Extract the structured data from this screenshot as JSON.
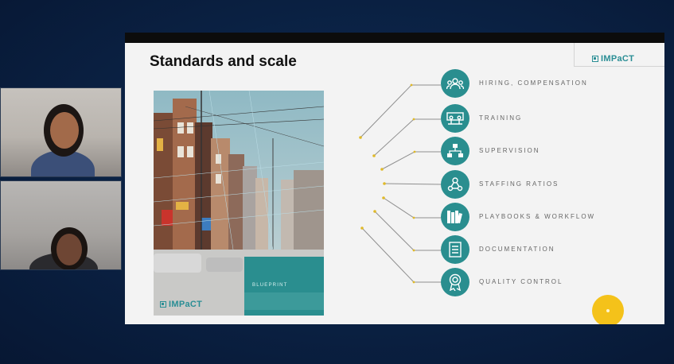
{
  "participants": [
    {
      "name": "participant-1",
      "skin": "#a26a4a",
      "hair": "#1c1614",
      "shirt": "#3b4f78"
    },
    {
      "name": "participant-2",
      "skin": "#6e4634",
      "hair": "#1a1411",
      "shirt": "#2a2a2e"
    }
  ],
  "slide": {
    "title": "Standards and scale",
    "logo_text": "IMPaCT",
    "cover": {
      "label": "BLUEPRINT",
      "logo_text": "IMPaCT"
    },
    "items": [
      {
        "label": "HIRING, COMPENSATION",
        "icon": "people-group-icon"
      },
      {
        "label": "TRAINING",
        "icon": "classroom-icon"
      },
      {
        "label": "SUPERVISION",
        "icon": "org-chart-icon"
      },
      {
        "label": "STAFFING RATIOS",
        "icon": "staff-network-icon"
      },
      {
        "label": "PLAYBOOKS & WORKFLOW",
        "icon": "books-icon"
      },
      {
        "label": "DOCUMENTATION",
        "icon": "checklist-icon"
      },
      {
        "label": "QUALITY CONTROL",
        "icon": "award-ribbon-icon"
      }
    ]
  },
  "colors": {
    "teal": "#2a8e8f",
    "accent_line": "#e0b928",
    "bubble": "#f4c21a"
  }
}
